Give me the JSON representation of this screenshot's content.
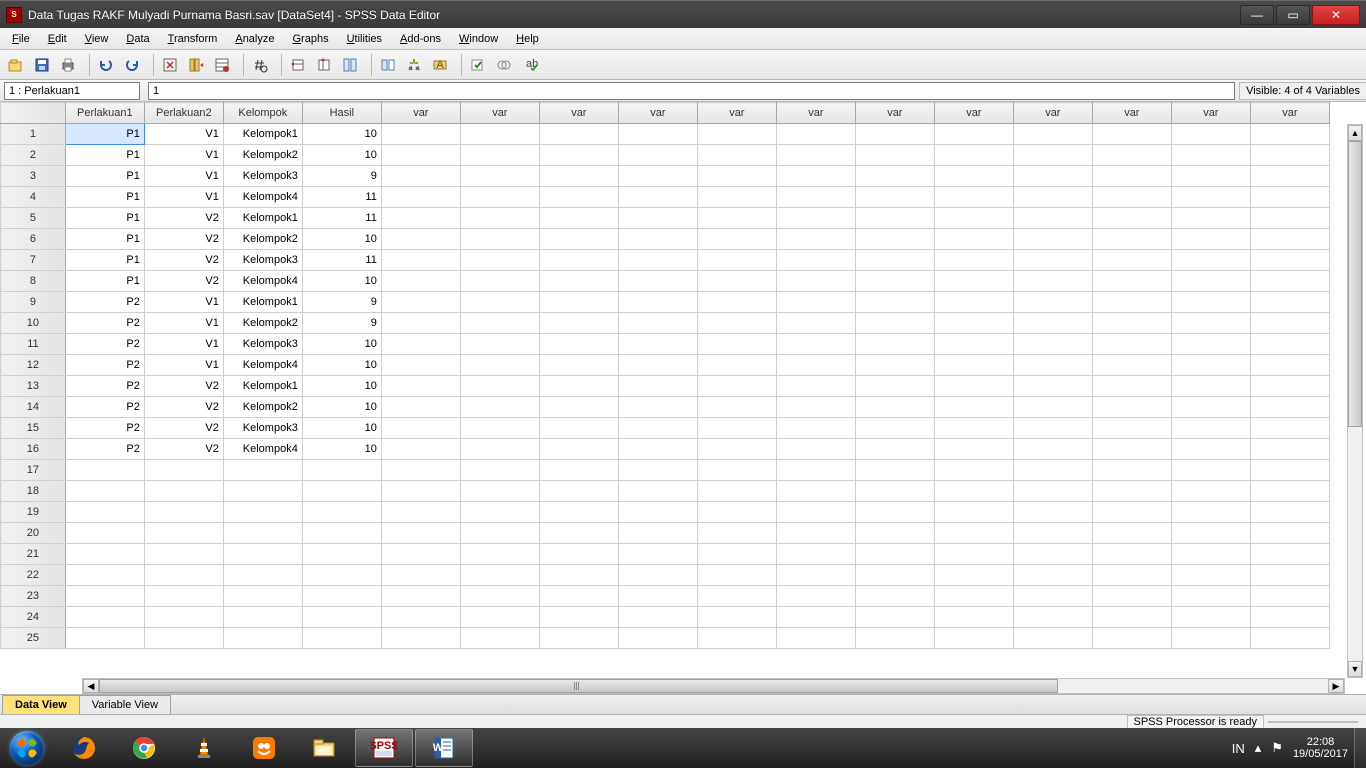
{
  "window": {
    "title": "Data Tugas RAKF Mulyadi Purnama Basri.sav [DataSet4] - SPSS Data Editor"
  },
  "menu": [
    "File",
    "Edit",
    "View",
    "Data",
    "Transform",
    "Analyze",
    "Graphs",
    "Utilities",
    "Add-ons",
    "Window",
    "Help"
  ],
  "refbar": {
    "cellref": "1 : Perlakuan1",
    "cellval": "1",
    "visible": "Visible: 4 of 4 Variables"
  },
  "columns": [
    "Perlakuan1",
    "Perlakuan2",
    "Kelompok",
    "Hasil",
    "var",
    "var",
    "var",
    "var",
    "var",
    "var",
    "var",
    "var",
    "var",
    "var",
    "var",
    "var"
  ],
  "rows": [
    {
      "n": "1",
      "c": [
        "P1",
        "V1",
        "Kelompok1",
        "10"
      ]
    },
    {
      "n": "2",
      "c": [
        "P1",
        "V1",
        "Kelompok2",
        "10"
      ]
    },
    {
      "n": "3",
      "c": [
        "P1",
        "V1",
        "Kelompok3",
        "9"
      ]
    },
    {
      "n": "4",
      "c": [
        "P1",
        "V1",
        "Kelompok4",
        "11"
      ]
    },
    {
      "n": "5",
      "c": [
        "P1",
        "V2",
        "Kelompok1",
        "11"
      ]
    },
    {
      "n": "6",
      "c": [
        "P1",
        "V2",
        "Kelompok2",
        "10"
      ]
    },
    {
      "n": "7",
      "c": [
        "P1",
        "V2",
        "Kelompok3",
        "11"
      ]
    },
    {
      "n": "8",
      "c": [
        "P1",
        "V2",
        "Kelompok4",
        "10"
      ]
    },
    {
      "n": "9",
      "c": [
        "P2",
        "V1",
        "Kelompok1",
        "9"
      ]
    },
    {
      "n": "10",
      "c": [
        "P2",
        "V1",
        "Kelompok2",
        "9"
      ]
    },
    {
      "n": "11",
      "c": [
        "P2",
        "V1",
        "Kelompok3",
        "10"
      ]
    },
    {
      "n": "12",
      "c": [
        "P2",
        "V1",
        "Kelompok4",
        "10"
      ]
    },
    {
      "n": "13",
      "c": [
        "P2",
        "V2",
        "Kelompok1",
        "10"
      ]
    },
    {
      "n": "14",
      "c": [
        "P2",
        "V2",
        "Kelompok2",
        "10"
      ]
    },
    {
      "n": "15",
      "c": [
        "P2",
        "V2",
        "Kelompok3",
        "10"
      ]
    },
    {
      "n": "16",
      "c": [
        "P2",
        "V2",
        "Kelompok4",
        "10"
      ]
    },
    {
      "n": "17",
      "c": [
        "",
        "",
        "",
        ""
      ]
    },
    {
      "n": "18",
      "c": [
        "",
        "",
        "",
        ""
      ]
    },
    {
      "n": "19",
      "c": [
        "",
        "",
        "",
        ""
      ]
    },
    {
      "n": "20",
      "c": [
        "",
        "",
        "",
        ""
      ]
    },
    {
      "n": "21",
      "c": [
        "",
        "",
        "",
        ""
      ]
    },
    {
      "n": "22",
      "c": [
        "",
        "",
        "",
        ""
      ]
    },
    {
      "n": "23",
      "c": [
        "",
        "",
        "",
        ""
      ]
    },
    {
      "n": "24",
      "c": [
        "",
        "",
        "",
        ""
      ]
    },
    {
      "n": "25",
      "c": [
        "",
        "",
        "",
        ""
      ]
    }
  ],
  "tabs": {
    "data": "Data View",
    "variable": "Variable View"
  },
  "status": {
    "proc": "SPSS Processor is ready"
  },
  "taskbar": {
    "lang": "IN",
    "time": "22:08",
    "date": "19/05/2017"
  }
}
